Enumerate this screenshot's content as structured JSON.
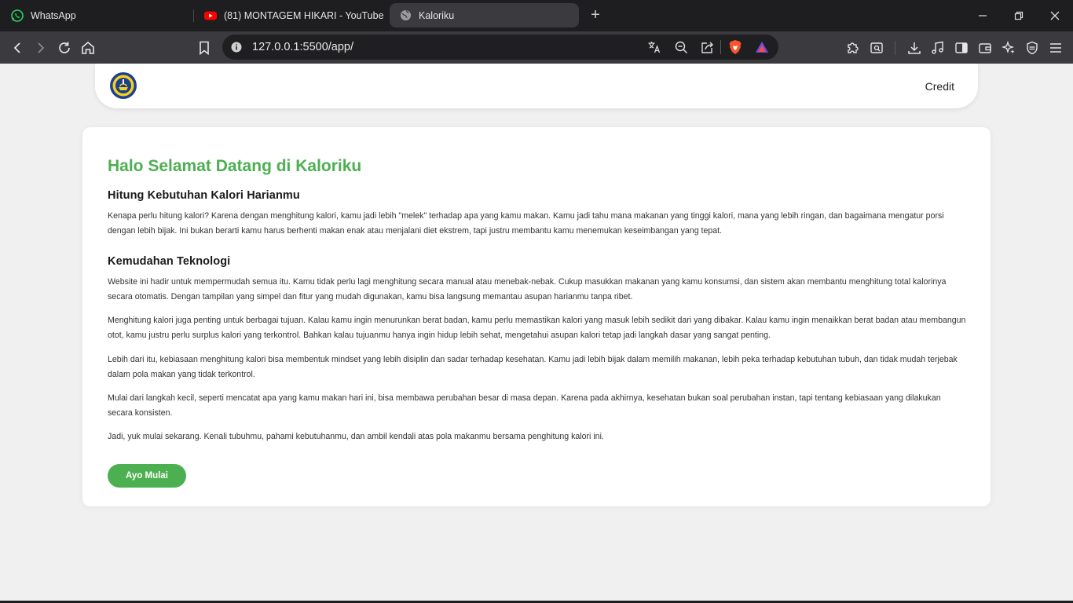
{
  "browser": {
    "tabs": [
      {
        "title": "WhatsApp",
        "icon": "whatsapp-icon",
        "active": false
      },
      {
        "title": "(81) MONTAGEM HIKARI - YouTube",
        "icon": "youtube-icon",
        "active": false
      },
      {
        "title": "Kaloriku",
        "icon": "globe-icon",
        "active": true
      }
    ],
    "new_tab_label": "+",
    "url": "127.0.0.1:5500/app/"
  },
  "nav": {
    "credit": "Credit"
  },
  "content": {
    "title": "Halo Selamat Datang di Kaloriku",
    "section1_heading": "Hitung Kebutuhan Kalori Harianmu",
    "section1_p1": "Kenapa perlu hitung kalori? Karena dengan menghitung kalori, kamu jadi lebih \"melek\" terhadap apa yang kamu makan. Kamu jadi tahu mana makanan yang tinggi kalori, mana yang lebih ringan, dan bagaimana mengatur porsi dengan lebih bijak. Ini bukan berarti kamu harus berhenti makan enak atau menjalani diet ekstrem, tapi justru membantu kamu menemukan keseimbangan yang tepat.",
    "section2_heading": "Kemudahan Teknologi",
    "section2_p1": "Website ini hadir untuk mempermudah semua itu. Kamu tidak perlu lagi menghitung secara manual atau menebak-nebak. Cukup masukkan makanan yang kamu konsumsi, dan sistem akan membantu menghitung total kalorinya secara otomatis. Dengan tampilan yang simpel dan fitur yang mudah digunakan, kamu bisa langsung memantau asupan harianmu tanpa ribet.",
    "section2_p2": "Menghitung kalori juga penting untuk berbagai tujuan. Kalau kamu ingin menurunkan berat badan, kamu perlu memastikan kalori yang masuk lebih sedikit dari yang dibakar. Kalau kamu ingin menaikkan berat badan atau membangun otot, kamu justru perlu surplus kalori yang terkontrol. Bahkan kalau tujuanmu hanya ingin hidup lebih sehat, mengetahui asupan kalori tetap jadi langkah dasar yang sangat penting.",
    "section2_p3": "Lebih dari itu, kebiasaan menghitung kalori bisa membentuk mindset yang lebih disiplin dan sadar terhadap kesehatan. Kamu jadi lebih bijak dalam memilih makanan, lebih peka terhadap kebutuhan tubuh, dan tidak mudah terjebak dalam pola makan yang tidak terkontrol.",
    "section2_p4": "Mulai dari langkah kecil, seperti mencatat apa yang kamu makan hari ini, bisa membawa perubahan besar di masa depan. Karena pada akhirnya, kesehatan bukan soal perubahan instan, tapi tentang kebiasaan yang dilakukan secara konsisten.",
    "section2_p5": "Jadi, yuk mulai sekarang. Kenali tubuhmu, pahami kebutuhanmu, dan ambil kendali atas pola makanmu bersama penghitung kalori ini.",
    "cta": "Ayo Mulai"
  },
  "colors": {
    "accent": "#4caf50",
    "browser_dark": "#1e1e21",
    "toolbar": "#3b3b3f"
  }
}
